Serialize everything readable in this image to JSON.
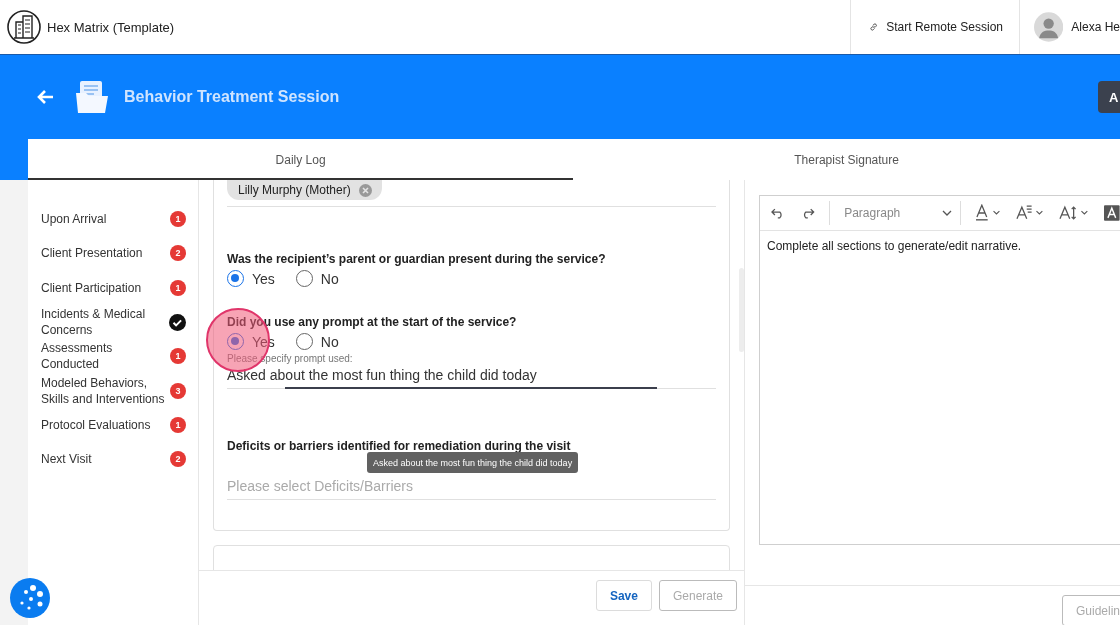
{
  "app": {
    "title": "Hex Matrix (Template)",
    "remote_session": "Start Remote Session",
    "user_name": "Alexa He"
  },
  "page": {
    "title": "Behavior Treatment Session",
    "action_button": "A"
  },
  "tabs": [
    {
      "label": "Daily Log",
      "selected": true
    },
    {
      "label": "Therapist Signature",
      "selected": false
    }
  ],
  "sidebar": {
    "items": [
      {
        "label": "Upon Arrival",
        "kind": "count",
        "badge": "1"
      },
      {
        "label": "Client Presentation",
        "kind": "count",
        "badge": "2"
      },
      {
        "label": "Client Participation",
        "kind": "count",
        "badge": "1"
      },
      {
        "label": "Incidents & Medical Concerns",
        "kind": "done"
      },
      {
        "label": "Assessments Conducted",
        "kind": "count",
        "badge": "1"
      },
      {
        "label": "Modeled Behaviors, Skills and Interventions",
        "kind": "count",
        "badge": "3"
      },
      {
        "label": "Protocol Evaluations",
        "kind": "count",
        "badge": "1"
      },
      {
        "label": "Next Visit",
        "kind": "count",
        "badge": "2"
      }
    ]
  },
  "form": {
    "chips": [
      {
        "label": "Lilly Murphy (Mother)"
      }
    ],
    "questions": [
      {
        "kind": "radio",
        "label": "Was the recipient’s parent or guardian present during the service?",
        "options": [
          {
            "label": "Yes",
            "selected": true
          },
          {
            "label": "No",
            "selected": false
          }
        ]
      },
      {
        "kind": "radio",
        "label": "Did you use any prompt at the start of the service?",
        "options": [
          {
            "label": "Yes",
            "selected": true
          },
          {
            "label": "No",
            "selected": false
          }
        ],
        "detail": {
          "label": "Please specify prompt used:",
          "value": "Asked about the most fun thing the child did today"
        }
      },
      {
        "kind": "select",
        "label": "Deficits or barriers identified for remediation during the visit",
        "placeholder": "Please select Deficits/Barriers"
      }
    ],
    "tooltip": "Asked about the most fun thing the child did today",
    "buttons": [
      {
        "label": "Save",
        "disabled": false
      },
      {
        "label": "Generate",
        "disabled": true
      }
    ]
  },
  "editor": {
    "block_style": "Paragraph",
    "text": "Complete all sections to generate/edit narrative.",
    "button": "Guidelin"
  }
}
